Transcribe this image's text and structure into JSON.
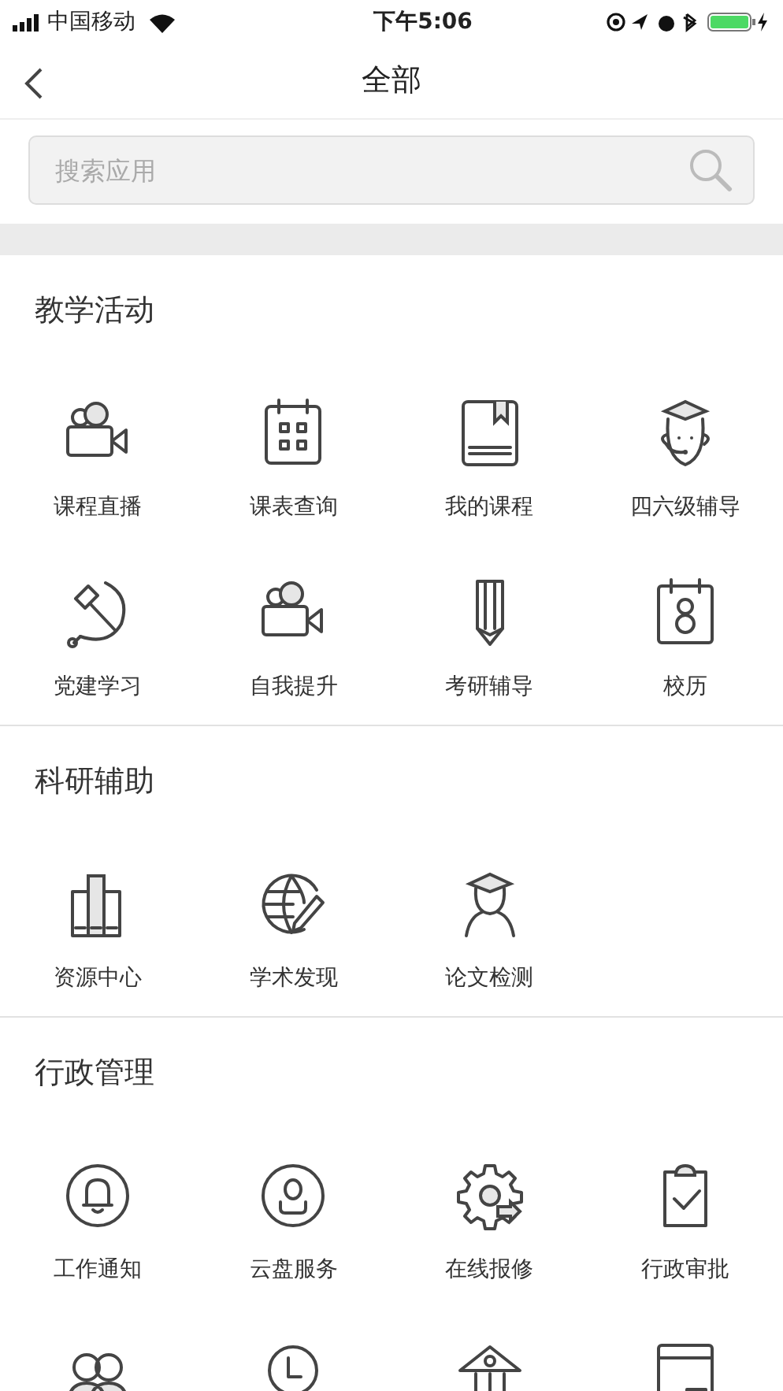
{
  "status_bar": {
    "carrier": "中国移动",
    "time": "下午5:06"
  },
  "nav": {
    "title": "全部"
  },
  "search": {
    "placeholder": "搜索应用"
  },
  "sections": [
    {
      "title": "教学活动",
      "items": [
        {
          "label": "课程直播"
        },
        {
          "label": "课表查询"
        },
        {
          "label": "我的课程"
        },
        {
          "label": "四六级辅导"
        },
        {
          "label": "党建学习"
        },
        {
          "label": "自我提升"
        },
        {
          "label": "考研辅导"
        },
        {
          "label": "校历"
        }
      ]
    },
    {
      "title": "科研辅助",
      "items": [
        {
          "label": "资源中心"
        },
        {
          "label": "学术发现"
        },
        {
          "label": "论文检测"
        }
      ]
    },
    {
      "title": "行政管理",
      "items": [
        {
          "label": "工作通知"
        },
        {
          "label": "云盘服务"
        },
        {
          "label": "在线报修"
        },
        {
          "label": "行政审批"
        }
      ]
    }
  ]
}
